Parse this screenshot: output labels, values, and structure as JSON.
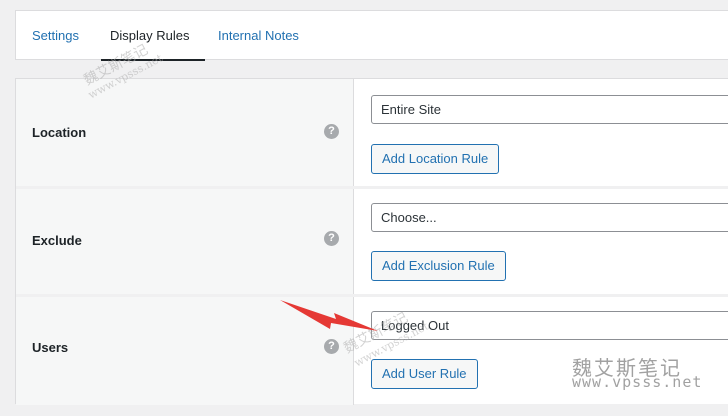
{
  "tabs": [
    {
      "label": "Settings",
      "active": false
    },
    {
      "label": "Display Rules",
      "active": true
    },
    {
      "label": "Internal Notes",
      "active": false
    }
  ],
  "rules": {
    "location": {
      "label": "Location",
      "help": "?",
      "select_value": "Entire Site",
      "button": "Add Location Rule"
    },
    "exclude": {
      "label": "Exclude",
      "help": "?",
      "select_value": "Choose...",
      "button": "Add Exclusion Rule"
    },
    "users": {
      "label": "Users",
      "help": "?",
      "select_value": "Logged Out",
      "button": "Add User Rule"
    }
  },
  "watermark": {
    "cn": "魏艾斯笔记",
    "url": "www.vpsss.net"
  },
  "colors": {
    "link": "#2271b1",
    "arrow": "#e53935",
    "text": "#1d2327"
  }
}
